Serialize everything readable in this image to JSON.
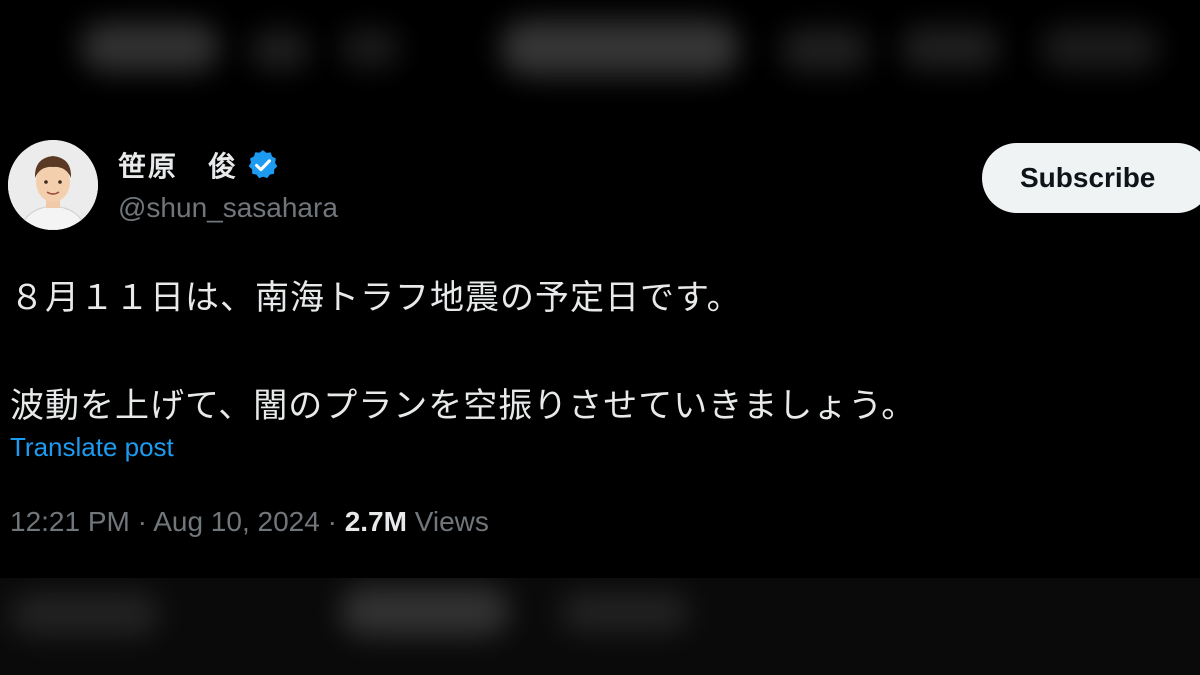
{
  "tweet": {
    "author": {
      "display_name": "笹原　俊",
      "handle": "@shun_sasahara",
      "verified_icon": "verified-badge-icon",
      "avatar": "avatar-illustration"
    },
    "subscribe_label": "Subscribe",
    "text_lines": [
      "８月１１日は、南海トラフ地震の予定日です。",
      "波動を上げて、闇のプランを空振りさせていきましょう。"
    ],
    "translate_label": "Translate post",
    "meta": {
      "time": "12:21 PM",
      "separator": "·",
      "date": "Aug 10, 2024",
      "views_count": "2.7M",
      "views_label": "Views"
    }
  },
  "colors": {
    "background": "#000000",
    "text_primary": "#e7e9ea",
    "text_secondary": "#71767b",
    "link_blue": "#1d9bf0",
    "verified_blue": "#1d9bf0",
    "button_bg": "#eff3f4"
  }
}
